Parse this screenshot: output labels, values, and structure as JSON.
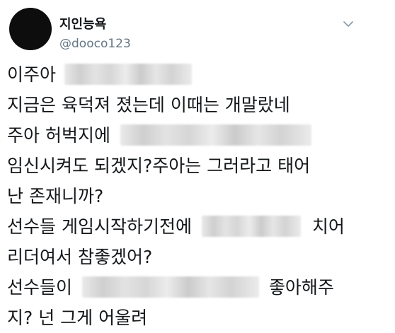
{
  "user": {
    "display_name": "지인능욕",
    "handle": "@dooco123"
  },
  "icons": {
    "menu": "chevron-down-icon"
  },
  "tweet": {
    "line1": "이주아",
    "line2": "지금은 육덕져 졌는데 이때는 개말랐네",
    "line3": "주아 허벅지에",
    "line4": "임신시켜도 되겠지?주아는 그러라고 태어",
    "line5": "난 존재니까?",
    "line6_a": "선수들 게임시작하기전에",
    "line6_b": "치어",
    "line7": "리더여서 참좋겠어?",
    "line8_a": "선수들이",
    "line8_b": "좋아해주",
    "line9": "지? 넌 그게 어울려"
  }
}
